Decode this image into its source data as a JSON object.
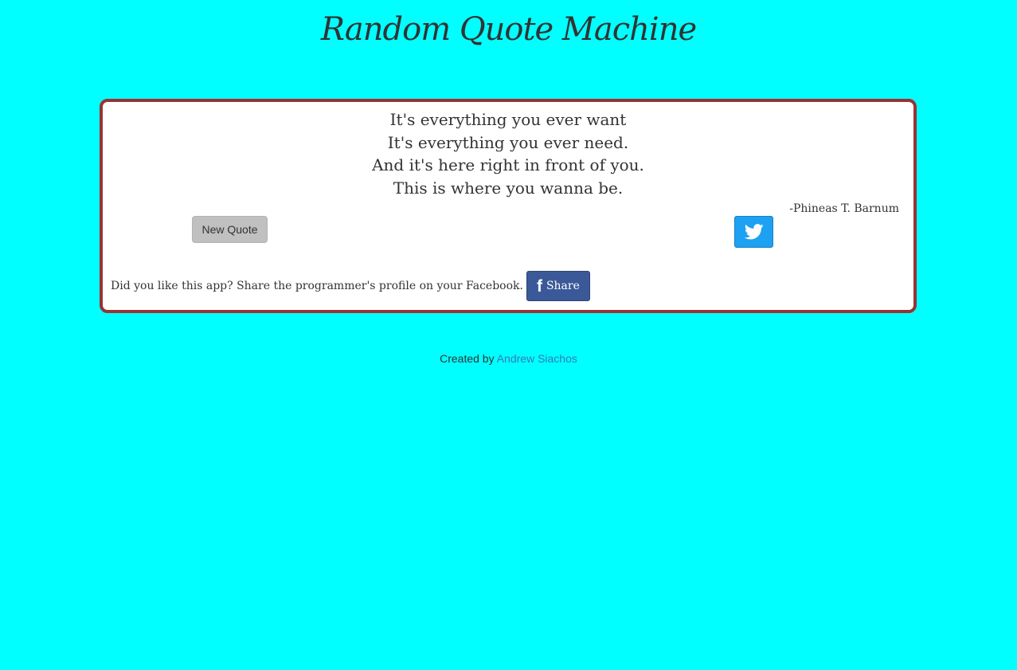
{
  "header": {
    "title": "Random Quote Machine"
  },
  "quote": {
    "lines": [
      "It's everything you ever want",
      "It's everything you ever need.",
      "And it's here right in front of you.",
      "This is where you wanna be."
    ],
    "author": "-Phineas T. Barnum"
  },
  "actions": {
    "new_quote_label": "New Quote",
    "tweet_icon": "twitter-icon"
  },
  "share": {
    "prompt": "Did you like this app? Share the programmer's profile on your Facebook.",
    "button_label": "Share",
    "button_icon": "facebook-icon"
  },
  "footer": {
    "prefix": "Created by",
    "author_link": "Andrew Siachos"
  },
  "colors": {
    "background": "#00ffff",
    "card_border": "#993333",
    "twitter_blue": "#1da1f2",
    "facebook_blue": "#3b5998",
    "link": "#337ab7"
  }
}
